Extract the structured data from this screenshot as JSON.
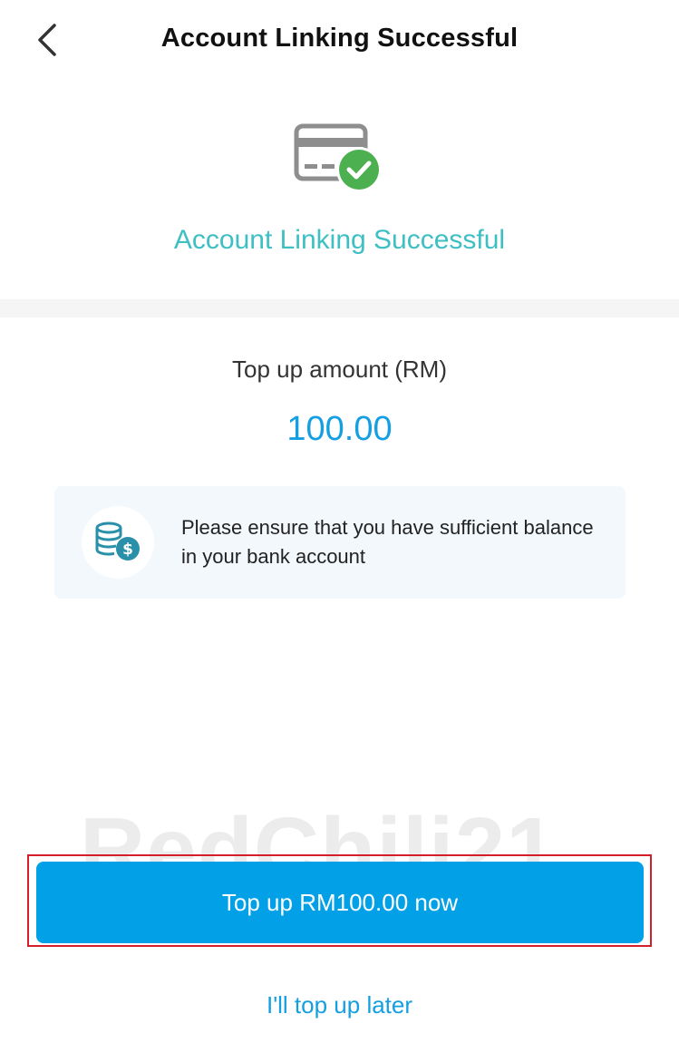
{
  "header": {
    "title": "Account Linking Successful",
    "back_icon": "chevron-left-icon"
  },
  "status": {
    "icon": "card-check-icon",
    "message": "Account Linking Successful",
    "accent_color": "#3dbfc3",
    "check_color": "#4caf50"
  },
  "topup": {
    "label": "Top up amount (RM)",
    "amount": "100.00",
    "amount_color": "#139fe2"
  },
  "notice": {
    "icon": "coins-dollar-icon",
    "text": "Please ensure that you have sufficient balance in your bank account"
  },
  "watermark": {
    "text": "RedChili21"
  },
  "actions": {
    "primary_label": "Top up RM100.00 now",
    "primary_color": "#02a0e6",
    "secondary_label": "I'll top up later",
    "highlight_color": "#d41f2b"
  }
}
